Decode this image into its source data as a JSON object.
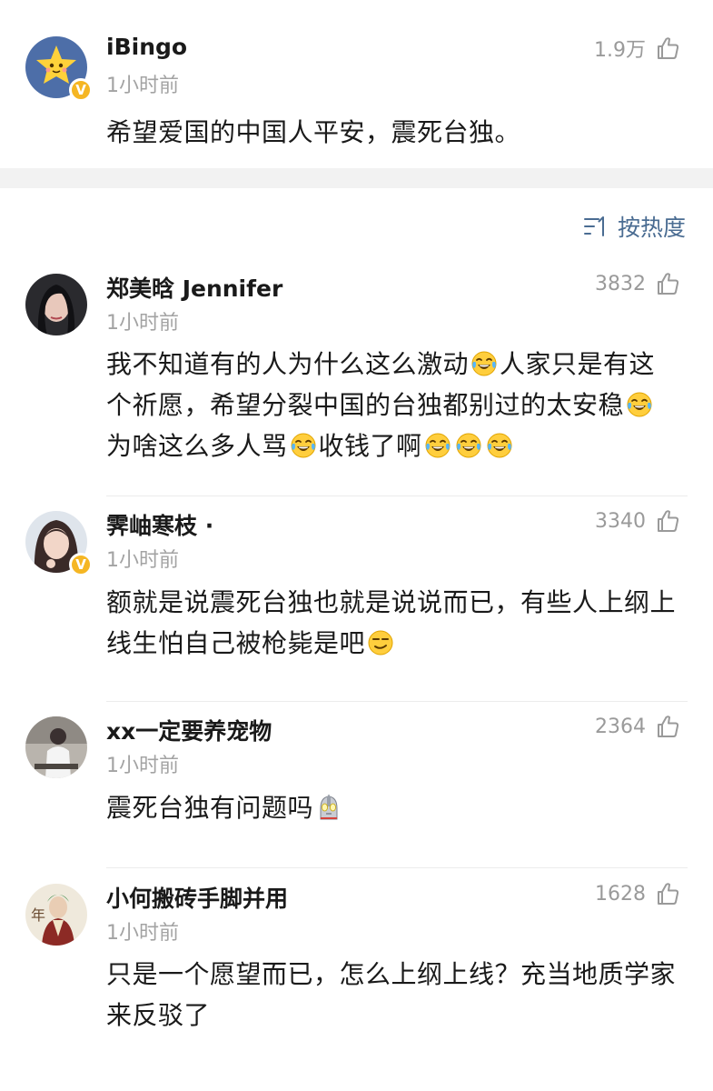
{
  "post": {
    "author": "iBingo",
    "time": "1小时前",
    "likes": "1.9万",
    "text": "希望爱国的中国人平安，震死台独。",
    "verified_badge": "V"
  },
  "sort": {
    "label": "按热度",
    "icon": "sort-icon"
  },
  "comments": [
    {
      "author": "郑美晗 Jennifer",
      "time": "1小时前",
      "likes": "3832",
      "segments": [
        "我不知道有的人为什么这么激动",
        "人家只是有这个祈愿，希望分裂中国的台独都别过的太安稳",
        "为啥这么多人骂",
        "收钱了啊"
      ],
      "emoji": "laughing-crying-emoji"
    },
    {
      "author": "霁岫寒枝 ·",
      "time": "1小时前",
      "likes": "3340",
      "text": "额就是说震死台独也就是说说而已，有些人上纲上线生怕自己被枪毙是吧",
      "emoji": "smirk-emoji",
      "verified_badge": "V"
    },
    {
      "author": "xx一定要养宠物",
      "time": "1小时前",
      "likes": "2364",
      "text": "震死台独有问题吗",
      "emoji": "ultraman-emoji"
    },
    {
      "author": "小何搬砖手脚并用",
      "time": "1小时前",
      "likes": "1628",
      "text": "只是一个愿望而已，怎么上纲上线？充当地质学家来反驳了",
      "avatar_text": "年"
    }
  ],
  "colors": {
    "accent": "#4a6c92",
    "gray_text": "#a3a3a3",
    "badge": "#f5b623",
    "separator": "#f2f2f2"
  }
}
